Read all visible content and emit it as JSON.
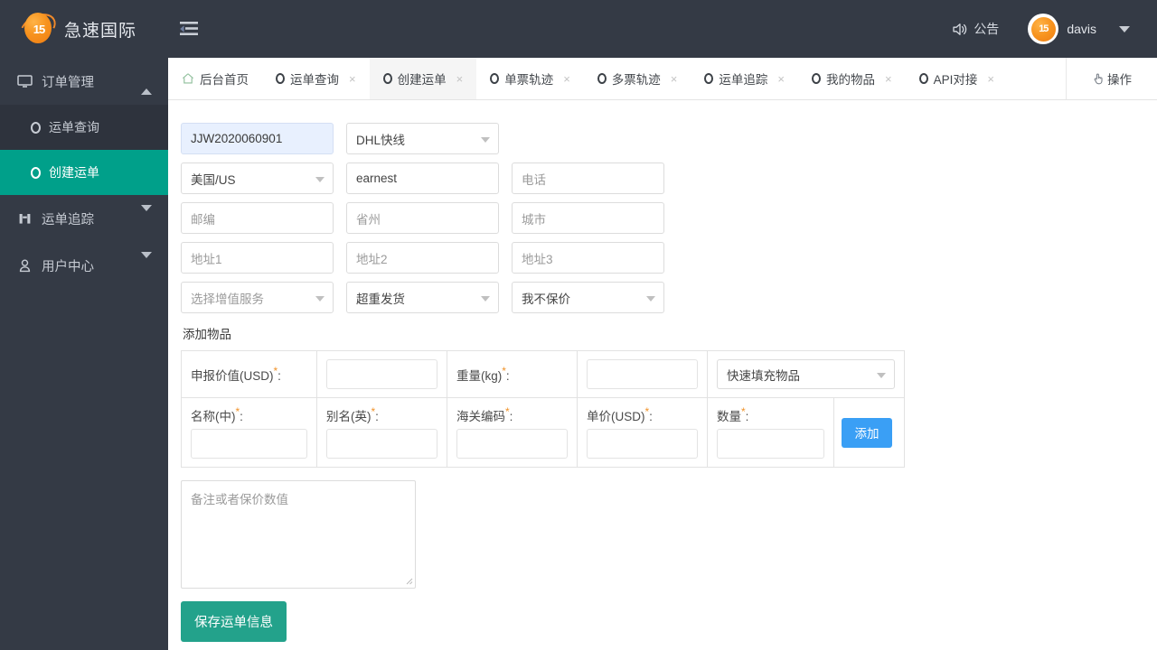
{
  "header": {
    "logo_number": "15",
    "brand": "急速国际",
    "collapse_icon": "collapse-menu-icon",
    "notice_label": "公告",
    "notice_icon": "speaker-icon",
    "user_name": "davis",
    "avatar_number": "15"
  },
  "sidebar": {
    "groups": [
      {
        "label": "订单管理",
        "icon": "monitor-icon",
        "expanded": true,
        "arrow": "up",
        "items": [
          {
            "label": "运单查询",
            "state": "hover"
          },
          {
            "label": "创建运单",
            "state": "active"
          }
        ]
      },
      {
        "label": "运单追踪",
        "icon": "binoculars-icon",
        "expanded": false,
        "arrow": "down",
        "items": []
      },
      {
        "label": "用户中心",
        "icon": "user-icon",
        "expanded": false,
        "arrow": "down",
        "items": []
      }
    ]
  },
  "tabbar": {
    "tabs": [
      {
        "label": "后台首页",
        "icon": "home-icon",
        "closable": false,
        "active": false
      },
      {
        "label": "运单查询",
        "icon": "ring-icon",
        "closable": true,
        "active": false
      },
      {
        "label": "创建运单",
        "icon": "ring-icon",
        "closable": true,
        "active": true
      },
      {
        "label": "单票轨迹",
        "icon": "ring-icon",
        "closable": true,
        "active": false
      },
      {
        "label": "多票轨迹",
        "icon": "ring-icon",
        "closable": true,
        "active": false
      },
      {
        "label": "运单追踪",
        "icon": "ring-icon",
        "closable": true,
        "active": false
      },
      {
        "label": "我的物品",
        "icon": "ring-icon",
        "closable": true,
        "active": false
      },
      {
        "label": "API对接",
        "icon": "ring-icon",
        "closable": true,
        "active": false
      }
    ],
    "close_glyph": "×",
    "action_label": "操作",
    "action_icon": "hand-click-icon"
  },
  "form": {
    "row1": [
      {
        "name": "order-number",
        "value": "JJW2020060901",
        "placeholder": "",
        "type": "text",
        "autofill": true
      },
      {
        "name": "carrier-select",
        "value": "DHL快线",
        "placeholder": "",
        "type": "select"
      }
    ],
    "row2": [
      {
        "name": "country-select",
        "value": "美国/US",
        "placeholder": "",
        "type": "select"
      },
      {
        "name": "recipient-name",
        "value": "earnest",
        "placeholder": "",
        "type": "text"
      },
      {
        "name": "phone",
        "value": "",
        "placeholder": "电话",
        "type": "text"
      }
    ],
    "row3": [
      {
        "name": "postcode",
        "value": "",
        "placeholder": "邮编",
        "type": "text"
      },
      {
        "name": "province",
        "value": "",
        "placeholder": "省州",
        "type": "text"
      },
      {
        "name": "city",
        "value": "",
        "placeholder": "城市",
        "type": "text"
      }
    ],
    "row4": [
      {
        "name": "address1",
        "value": "",
        "placeholder": "地址1",
        "type": "text"
      },
      {
        "name": "address2",
        "value": "",
        "placeholder": "地址2",
        "type": "text"
      },
      {
        "name": "address3",
        "value": "",
        "placeholder": "地址3",
        "type": "text"
      }
    ],
    "row5": [
      {
        "name": "value-added-service-select",
        "value": "选择增值服务",
        "placeholder": "",
        "type": "select"
      },
      {
        "name": "overweight-shipping-select",
        "value": "超重发货",
        "placeholder": "",
        "type": "select"
      },
      {
        "name": "insurance-select",
        "value": "我不保价",
        "placeholder": "",
        "type": "select"
      }
    ]
  },
  "items_section": {
    "title": "添加物品",
    "declared_value_label": "申报价值(USD)",
    "weight_label": "重量(kg)",
    "quick_fill_value": "快速填充物品",
    "name_cn_label": "名称(中)",
    "name_en_label": "别名(英)",
    "hs_code_label": "海关编码",
    "unit_price_label": "单价(USD)",
    "quantity_label": "数量",
    "required_mark": "*",
    "colon": ":",
    "add_button": "添加",
    "declared_value": "",
    "weight": "",
    "name_cn": "",
    "name_en": "",
    "hs_code": "",
    "unit_price": "",
    "quantity": ""
  },
  "notes": {
    "placeholder": "备注或者保价数值",
    "value": ""
  },
  "actions": {
    "save_label": "保存运单信息"
  },
  "colors": {
    "sidebar_bg": "#343a45",
    "active_green": "#00a08a",
    "save_green": "#23a28b",
    "add_blue": "#3a9ff5",
    "required_orange": "#f0932b",
    "autofill_blue": "#e8f0fe",
    "logo_orange": "#f7931e"
  }
}
